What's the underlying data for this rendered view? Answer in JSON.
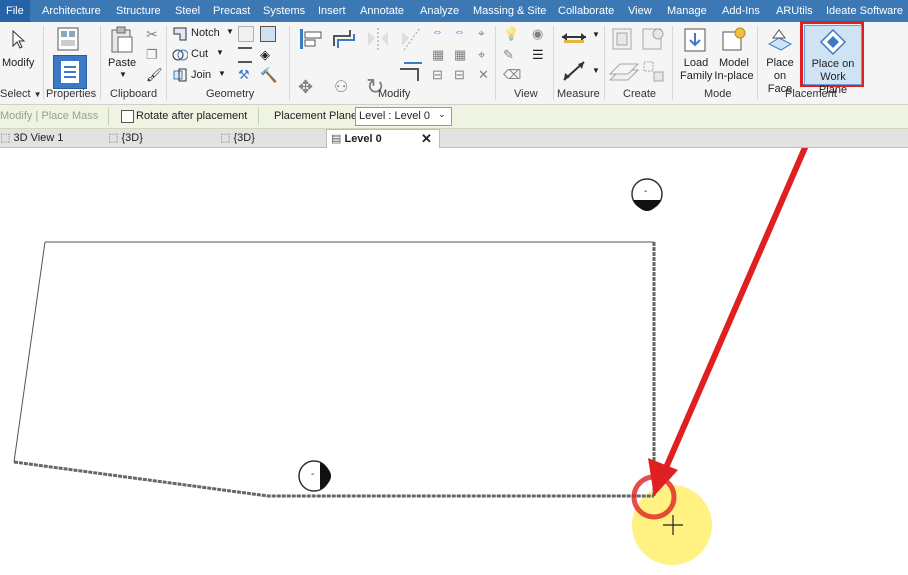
{
  "menu": {
    "tabs": [
      "File",
      "Architecture",
      "Structure",
      "Steel",
      "Precast",
      "Systems",
      "Insert",
      "Annotate",
      "Analyze",
      "Massing & Site",
      "Collaborate",
      "View",
      "Manage",
      "Add-Ins",
      "ARUtils",
      "Ideate Software"
    ]
  },
  "ribbon": {
    "select": {
      "modify_label": "Modify",
      "panel": "Select"
    },
    "properties": {
      "label": "Properties"
    },
    "clipboard": {
      "paste_label": "Paste",
      "panel": "Clipboard"
    },
    "geometry": {
      "notch": "Notch",
      "cut": "Cut",
      "join": "Join",
      "panel": "Geometry"
    },
    "modify_panel": {
      "panel": "Modify"
    },
    "view_panel": {
      "panel": "View"
    },
    "measure_panel": {
      "panel": "Measure"
    },
    "create_panel": {
      "panel": "Create"
    },
    "mode": {
      "load_family": "Load Family",
      "model_inplace": "Model In-place",
      "panel": "Mode"
    },
    "placement": {
      "place_on_face": "Place on Face",
      "place_on_work_plane": "Place on Work Plane",
      "panel": "Placement"
    }
  },
  "options_bar": {
    "context": "Modify | Place Mass",
    "rotate_label": "Rotate after placement",
    "rotate_checked": false,
    "placement_plane_label": "Placement Plane:",
    "placement_plane_value": "Level : Level 0"
  },
  "view_tabs": [
    {
      "label": "3D View 1",
      "active": false
    },
    {
      "label": "{3D}",
      "active": false
    },
    {
      "label": "{3D}",
      "active": false
    },
    {
      "label": "Level 0",
      "active": true
    }
  ],
  "canvas": {
    "marker_label": "-",
    "annotation_color": "#e02020",
    "highlight_color": "#fff176"
  }
}
